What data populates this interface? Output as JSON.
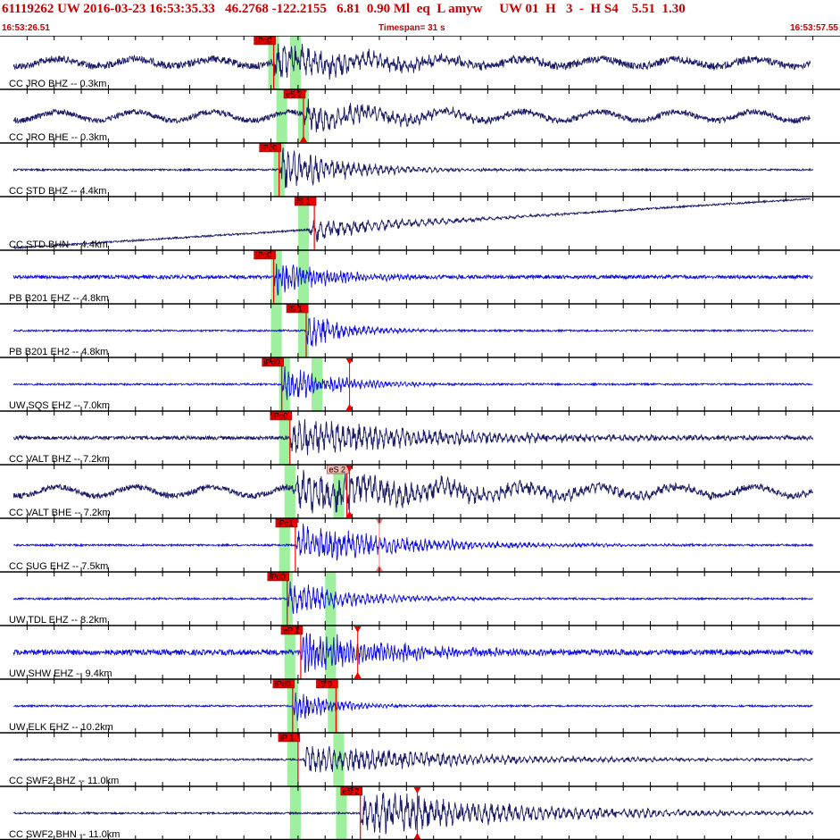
{
  "header": {
    "line1": "61119262 UW 2016-03-23 16:53:35.33   46.2768 -122.2155   6.81  0.90 Ml  eq  L amyw     UW 01  H   3  -  H S4    5.51  1.30",
    "start_time": "16:53:26.51",
    "timespan": "Timespan=  31 s",
    "end_time": "16:53:57.55"
  },
  "colors": {
    "text_red": "#cc0000",
    "pick_red": "#ee0000",
    "pick_label_bg_light": "#f4b8b0",
    "window_green": "#9ef09e",
    "trace_dark": "#1a1a66",
    "trace_blue": "#1010dd",
    "grid": "#000000"
  },
  "chart_data": {
    "type": "seismogram",
    "x_range": [
      0,
      31
    ],
    "x_unit": "s",
    "start_time": "16:53:26.51",
    "end_time": "16:53:57.55",
    "tick_interval_s": 1,
    "traces": [
      {
        "label": "CC JRO BHZ -- 0.3km",
        "color": "dark",
        "pick": {
          "label": "iPc0",
          "t": 10.1
        },
        "windows": [
          [
            9.9,
            10.3
          ],
          [
            10.7,
            11.1
          ]
        ],
        "arrival": 10.1,
        "amp": 22,
        "noise": 4,
        "decay": 3.5,
        "freq": 4.5,
        "baseline_tilt": 0,
        "end": 29.9,
        "long_period": 4
      },
      {
        "label": "CC JRO BHE -- 0.3km",
        "color": "dark",
        "pick": {
          "label": "eS 2",
          "t": 11.2,
          "marker": true
        },
        "windows": [
          [
            10.2,
            10.6
          ],
          [
            11.0,
            11.4
          ]
        ],
        "arrival": 11.2,
        "amp": 16,
        "noise": 3,
        "decay": 3.5,
        "freq": 4.5,
        "baseline_tilt": 0,
        "end": 29.9,
        "long_period": 5
      },
      {
        "label": "CC STD BHZ -- 4.4km",
        "color": "dark",
        "pick": {
          "label": "iPc0",
          "t": 10.3
        },
        "windows": [
          [
            10.1,
            10.5
          ]
        ],
        "arrival": 10.3,
        "amp": 24,
        "noise": 1,
        "decay": 2.5,
        "freq": 5.0,
        "baseline_tilt": 0,
        "end": 30.0,
        "long_period": 0
      },
      {
        "label": "CC STD BHN -- 4.4km",
        "color": "dark",
        "pick": {
          "label": "iS 1",
          "t": 11.6
        },
        "windows": [
          [
            11.0,
            11.4
          ]
        ],
        "arrival": 11.4,
        "amp": 14,
        "noise": 1,
        "decay": 3.0,
        "freq": 4.0,
        "baseline_tilt": 55,
        "end": 29.9,
        "long_period": 0
      },
      {
        "label": "PB B201 EHZ -- 4.8km",
        "color": "blue",
        "pick": {
          "label": "iPc0",
          "t": 10.1
        },
        "windows": [
          [
            10.0,
            10.4
          ],
          [
            11.0,
            11.4
          ]
        ],
        "arrival": 10.1,
        "amp": 20,
        "noise": 2,
        "decay": 2.0,
        "freq": 8.0,
        "baseline_tilt": 0,
        "end": 30.0,
        "long_period": 0
      },
      {
        "label": "PB B201 EH2 -- 4.8km",
        "color": "blue",
        "pick": {
          "label": "iS 1",
          "t": 11.3
        },
        "windows": [
          [
            10.0,
            10.4
          ],
          [
            11.0,
            11.4
          ]
        ],
        "arrival": 11.3,
        "amp": 22,
        "noise": 1,
        "decay": 1.5,
        "freq": 6.0,
        "baseline_tilt": 0,
        "end": 30.0,
        "long_period": 0
      },
      {
        "label": "UW SQS EHZ -- 7.0km",
        "color": "blue",
        "pick": {
          "label": "iPd0",
          "t": 10.4,
          "marker_t": 12.9
        },
        "windows": [
          [
            10.3,
            10.7
          ],
          [
            11.5,
            11.9
          ]
        ],
        "arrival": 10.4,
        "amp": 20,
        "noise": 1,
        "decay": 2.0,
        "freq": 7.0,
        "baseline_tilt": 0,
        "end": 30.0,
        "long_period": 0
      },
      {
        "label": "CC VALT BHZ -- 7.2km",
        "color": "dark",
        "pick": {
          "label": "iPc0",
          "t": 10.7
        },
        "windows": [
          [
            10.3,
            10.7
          ]
        ],
        "arrival": 10.7,
        "amp": 20,
        "noise": 2,
        "decay": 6.0,
        "freq": 5.0,
        "baseline_tilt": 0,
        "end": 30.0,
        "long_period": 0
      },
      {
        "label": "CC VALT BHE -- 7.2km",
        "color": "dark",
        "pick": {
          "label": "eS 2",
          "t": 12.8,
          "marker_t": 12.9,
          "light": true
        },
        "windows": [
          [
            10.5,
            10.9
          ],
          [
            12.3,
            12.7
          ]
        ],
        "arrival": 10.8,
        "amp": 22,
        "noise": 3,
        "decay": 7.0,
        "freq": 4.5,
        "baseline_tilt": 0,
        "end": 30.0,
        "long_period": 5
      },
      {
        "label": "CC SUG EHZ -- 7.5km",
        "color": "blue",
        "pick": {
          "label": "iPc1",
          "t": 10.9,
          "marker_t": 14.0,
          "light_marker": true
        },
        "windows": [
          [
            10.3,
            10.7
          ]
        ],
        "arrival": 10.9,
        "amp": 22,
        "noise": 1,
        "decay": 4.0,
        "freq": 6.0,
        "baseline_tilt": 0,
        "end": 30.0,
        "long_period": 0
      },
      {
        "label": "UW TDL EHZ -- 8.2km",
        "color": "blue",
        "pick": {
          "label": "iPd0",
          "t": 10.6
        },
        "windows": [
          [
            10.4,
            10.8
          ],
          [
            12.0,
            12.4
          ]
        ],
        "arrival": 10.6,
        "amp": 20,
        "noise": 1,
        "decay": 2.5,
        "freq": 6.0,
        "baseline_tilt": 0,
        "end": 30.0,
        "long_period": 0
      },
      {
        "label": "UW SHW EHZ -- 9.4km",
        "color": "blue",
        "pick": {
          "label": "eP 1",
          "t": 11.1,
          "marker_t": 13.2
        },
        "windows": [
          [
            10.5,
            10.9
          ],
          [
            12.0,
            12.4
          ]
        ],
        "arrival": 11.1,
        "amp": 22,
        "noise": 3,
        "decay": 3.5,
        "freq": 8.0,
        "baseline_tilt": 0,
        "end": 30.0,
        "long_period": 0
      },
      {
        "label": "UW ELK EHZ -- 10.2km",
        "color": "blue",
        "pick": {
          "label": "iPd0",
          "t": 10.8
        },
        "picks2": [
          {
            "label": "iS 0",
            "t": 12.4
          }
        ],
        "windows": [
          [
            10.6,
            11.0
          ],
          [
            12.1,
            12.5
          ]
        ],
        "arrival": 10.8,
        "amp": 18,
        "noise": 1,
        "decay": 1.5,
        "freq": 7.0,
        "baseline_tilt": 0,
        "end": 30.0,
        "long_period": 0
      },
      {
        "label": "CC SWF2 BHZ -- 11.0km",
        "color": "dark",
        "pick": {
          "label": "iP 1",
          "t": 11.0
        },
        "windows": [
          [
            10.6,
            11.0
          ],
          [
            12.3,
            12.7
          ]
        ],
        "arrival": 11.2,
        "amp": 16,
        "noise": 1,
        "decay": 6.0,
        "freq": 5.0,
        "baseline_tilt": 0,
        "end": 30.0,
        "long_period": 0
      },
      {
        "label": "CC SWF2 BHN -- 11.0km",
        "color": "dark",
        "pick": {
          "label": "eS 2",
          "t": 13.3,
          "marker_t": 15.4
        },
        "windows": [
          [
            10.7,
            11.1
          ],
          [
            12.4,
            12.8
          ]
        ],
        "arrival": 13.3,
        "amp": 24,
        "noise": 1,
        "decay": 6.0,
        "freq": 4.5,
        "baseline_tilt": 0,
        "end": 30.0,
        "long_period": 0
      }
    ]
  }
}
